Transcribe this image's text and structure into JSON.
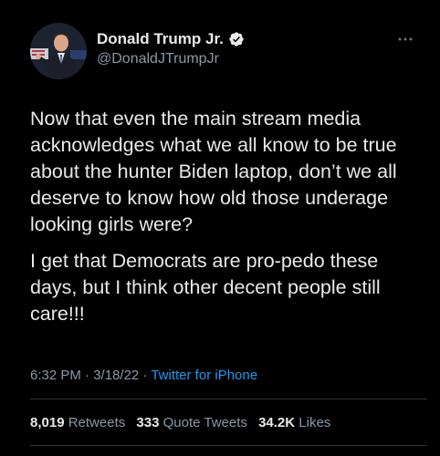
{
  "author": {
    "name": "Donald Trump Jr.",
    "handle": "@DonaldJTrumpJr",
    "verified_icon": "verified-badge-icon",
    "more_icon": "more-options-icon"
  },
  "tweet": {
    "paragraphs": [
      "Now that even the main stream media acknowledges what we all know to be true about the hunter Biden laptop, don’t we all deserve to know how old those underage looking girls were?",
      "I get that Democrats are pro-pedo these days, but I think other decent people still care!!!"
    ],
    "time": "6:32 PM",
    "date": "3/18/22",
    "separator": "·",
    "source": "Twitter for iPhone"
  },
  "stats": {
    "retweets_count": "8,019",
    "retweets_label": "Retweets",
    "quotes_count": "333",
    "quotes_label": "Quote Tweets",
    "likes_count": "34.2K",
    "likes_label": "Likes"
  },
  "colors": {
    "background": "#000000",
    "text_primary": "#e7e9ea",
    "text_secondary": "#8b98a5",
    "link": "#1d9bf0",
    "verified": "#e7e9ea"
  }
}
